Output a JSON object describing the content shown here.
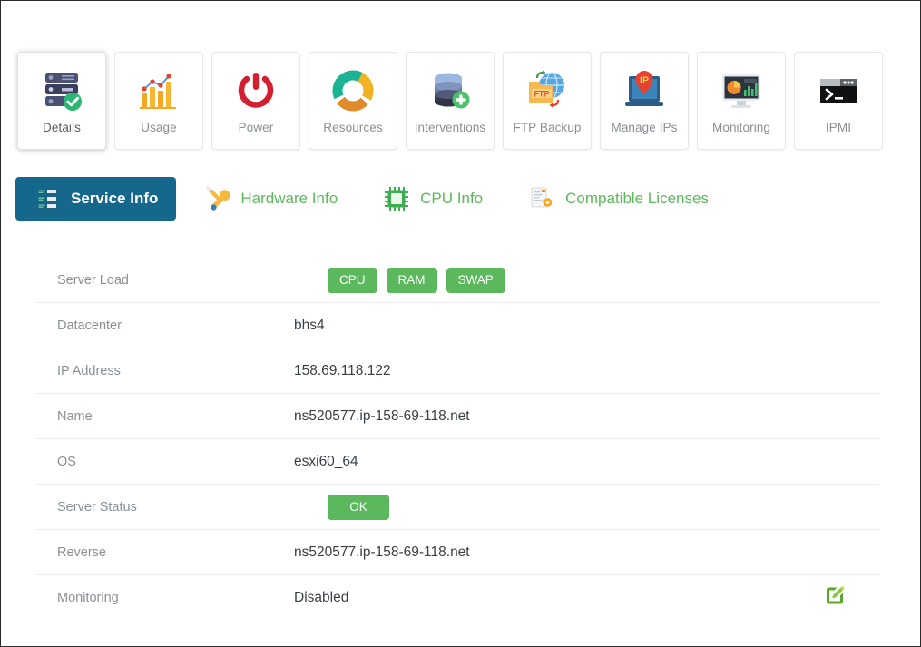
{
  "icon_tabs": [
    {
      "label": "Details",
      "icon": "server-rack-check-icon",
      "active": true
    },
    {
      "label": "Usage",
      "icon": "bar-chart-trend-icon",
      "active": false
    },
    {
      "label": "Power",
      "icon": "power-button-icon",
      "active": false
    },
    {
      "label": "Resources",
      "icon": "donut-chart-icon",
      "active": false
    },
    {
      "label": "Interventions",
      "icon": "database-plus-icon",
      "active": false
    },
    {
      "label": "FTP Backup",
      "icon": "ftp-folder-globe-icon",
      "active": false
    },
    {
      "label": "Manage IPs",
      "icon": "ip-pin-laptop-icon",
      "active": false
    },
    {
      "label": "Monitoring",
      "icon": "monitor-charts-icon",
      "active": false
    },
    {
      "label": "IPMI",
      "icon": "terminal-console-icon",
      "active": false
    }
  ],
  "sub_tabs": [
    {
      "label": "Service Info",
      "icon": "server-info-icon",
      "active": true
    },
    {
      "label": "Hardware Info",
      "icon": "wrench-screwdriver-icon",
      "active": false
    },
    {
      "label": "CPU Info",
      "icon": "cpu-chip-icon",
      "active": false
    },
    {
      "label": "Compatible Licenses",
      "icon": "document-gear-icon",
      "active": false
    }
  ],
  "info_rows": [
    {
      "label": "Server Load",
      "type": "badges",
      "badges": [
        "CPU",
        "RAM",
        "SWAP"
      ]
    },
    {
      "label": "Datacenter",
      "type": "text",
      "value": "bhs4"
    },
    {
      "label": "IP Address",
      "type": "text",
      "value": "158.69.118.122"
    },
    {
      "label": "Name",
      "type": "text",
      "value": "ns520577.ip-158-69-118.net"
    },
    {
      "label": "OS",
      "type": "text",
      "value": "esxi60_64"
    },
    {
      "label": "Server Status",
      "type": "badges",
      "badges": [
        "OK"
      ]
    },
    {
      "label": "Reverse",
      "type": "text",
      "value": "ns520577.ip-158-69-118.net"
    },
    {
      "label": "Monitoring",
      "type": "text",
      "value": "Disabled",
      "edit_icon": "edit-pencil-icon"
    }
  ],
  "colors": {
    "active_tab_bg": "#15688c",
    "success_green": "#5cb85c",
    "link_green": "#5cb85c",
    "label_gray": "#8a9096",
    "value_dark": "#3a3f44",
    "edit_green": "#5aa82e"
  }
}
